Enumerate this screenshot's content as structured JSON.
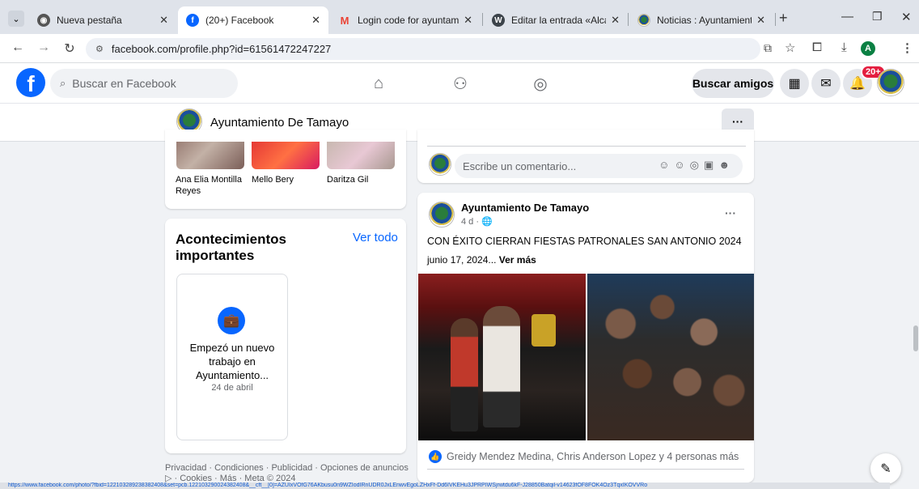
{
  "browser": {
    "tabs": [
      {
        "title": "Nueva pestaña"
      },
      {
        "title": "(20+) Facebook"
      },
      {
        "title": "Login code for ayuntamient"
      },
      {
        "title": "Editar la entrada «Alcaldesa"
      },
      {
        "title": "Noticias : Ayuntamiento de"
      }
    ],
    "new_tab": "+",
    "url": "facebook.com/profile.php?id=61561472247227",
    "profile_initial": "A",
    "status_url": "https://www.facebook.com/photo/?fbid=122103289238382408&set=pcb.122103290024382408&__cft__[0]=AZUIxVOfG76AKbusu0n9WZIodIRnUDR0JxLEnwvEgoLZHxFf-Dd6IVKEHu3JPRPIWSjrwtdu6kF-J28850Batqil-v14623fOF8FOK4Oz3TqxIKOVVRo"
  },
  "fb": {
    "search_placeholder": "Buscar en Facebook",
    "find_friends": "Buscar amigos",
    "notif_badge": "20+"
  },
  "profile": {
    "name": "Ayuntamiento De Tamayo",
    "more": "···"
  },
  "friends": [
    {
      "name": "Ana Elia Montilla Reyes"
    },
    {
      "name": "Mello Bery"
    },
    {
      "name": "Daritza Gil"
    }
  ],
  "events": {
    "heading": "Acontecimientos importantes",
    "see_all": "Ver todo",
    "item_text": "Empezó un nuevo trabajo en Ayuntamiento...",
    "item_date": "24 de abril"
  },
  "footer": {
    "line1": "Privacidad · Condiciones · Publicidad · Opciones de anuncios",
    "line2": "▷ · Cookies · Más · Meta © 2024"
  },
  "comment": {
    "placeholder": "Escribe un comentario..."
  },
  "post": {
    "author": "Ayuntamiento De Tamayo",
    "time": "4 d · ",
    "more": "···",
    "text": "CON ÉXITO CIERRAN FIESTAS PATRONALES SAN ANTONIO 2024",
    "date": "junio 17, 2024...",
    "see_more": "Ver más",
    "reactions": "Greidy Mendez Medina, Chris Anderson Lopez y 4 personas más"
  },
  "colors": {
    "fb_blue": "#0866ff",
    "badge_red": "#e41e3f"
  }
}
